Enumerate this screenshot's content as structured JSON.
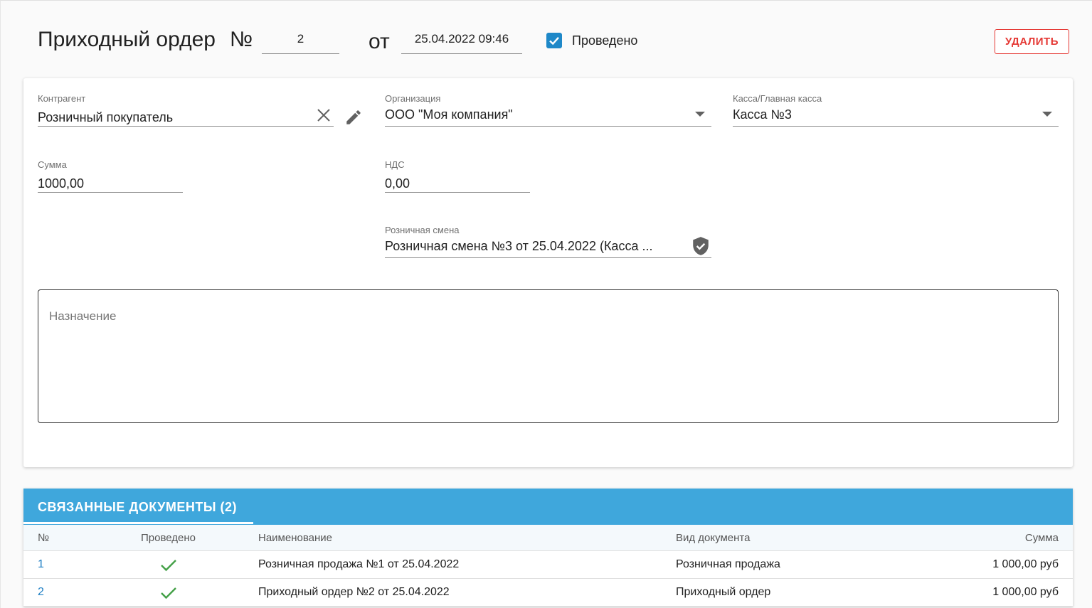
{
  "header": {
    "title": "Приходный ордер",
    "number_sign": "№",
    "number": "2",
    "from_label": "от",
    "date": "25.04.2022 09:46",
    "posted_checked": true,
    "posted_label": "Проведено",
    "delete_label": "УДАЛИТЬ"
  },
  "form": {
    "counterparty": {
      "label": "Контрагент",
      "value": "Розничный покупатель"
    },
    "organization": {
      "label": "Организация",
      "value": "ООО \"Моя компания\""
    },
    "cashbox": {
      "label": "Касса/Главная касса",
      "value": "Касса №3"
    },
    "amount": {
      "label": "Сумма",
      "value": "1000,00"
    },
    "vat": {
      "label": "НДС",
      "value": "0,00"
    },
    "retail_shift": {
      "label": "Розничная смена",
      "value": "Розничная смена №3 от 25.04.2022 (Касса ..."
    },
    "purpose": {
      "placeholder": "Назначение"
    }
  },
  "related": {
    "tab_label": "СВЯЗАННЫЕ ДОКУМЕНТЫ (2)",
    "columns": [
      "№",
      "Проведено",
      "Наименование",
      "Вид документа",
      "Сумма"
    ],
    "rows": [
      {
        "num": "1",
        "posted": true,
        "name": "Розничная продажа №1 от 25.04.2022",
        "type": "Розничная продажа",
        "sum": "1 000,00 руб"
      },
      {
        "num": "2",
        "posted": true,
        "name": "Приходный ордер №2 от 25.04.2022",
        "type": "Приходный ордер",
        "sum": "1 000,00 руб"
      }
    ]
  },
  "colors": {
    "accent": "#3fa7dc",
    "danger": "#e53935",
    "check": "#43a047",
    "link": "#1e7fc4"
  }
}
